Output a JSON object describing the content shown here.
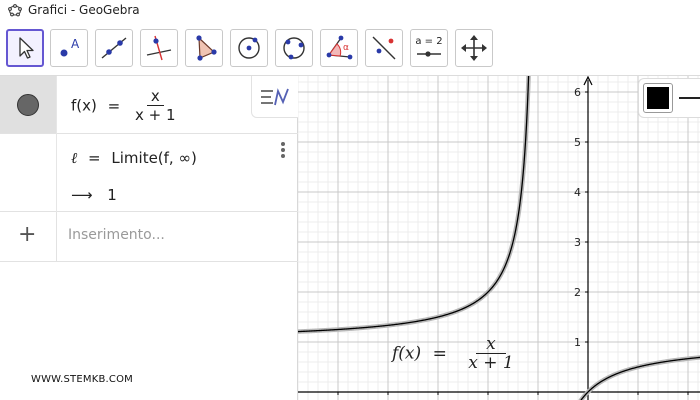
{
  "window": {
    "title": "Grafici - GeoGebra"
  },
  "toolbar": {
    "tools": [
      {
        "id": "move",
        "icon": "cursor-arrow-icon",
        "active": true
      },
      {
        "id": "point",
        "icon": "point-icon",
        "label": "A"
      },
      {
        "id": "line",
        "icon": "line-through-points-icon"
      },
      {
        "id": "perpendicular",
        "icon": "perpendicular-line-icon"
      },
      {
        "id": "polygon",
        "icon": "polygon-icon"
      },
      {
        "id": "circle-center",
        "icon": "circle-center-point-icon"
      },
      {
        "id": "circle-three",
        "icon": "circle-three-points-icon"
      },
      {
        "id": "angle",
        "icon": "angle-icon",
        "label": "α"
      },
      {
        "id": "reflect",
        "icon": "reflect-line-icon"
      },
      {
        "id": "slider",
        "icon": "slider-icon",
        "label": "a = 2"
      },
      {
        "id": "move-view",
        "icon": "move-graphics-view-icon"
      }
    ]
  },
  "algebra": {
    "row1": {
      "name": "f(x)",
      "eq": "=",
      "num": "x",
      "den": "x + 1"
    },
    "row2": {
      "lhs": "ℓ",
      "eq": "=",
      "command": "Limite(f, ∞)",
      "arrow": "⟶",
      "result": "1"
    },
    "input": {
      "plus": "+",
      "placeholder": "Inserimento..."
    }
  },
  "watermark": "WWW.STEMKB.COM",
  "graphics": {
    "y_ticks": [
      "1",
      "2",
      "3",
      "4",
      "5",
      "6"
    ],
    "label": {
      "name": "f(x)",
      "eq": "=",
      "num": "x",
      "den": "x + 1"
    },
    "colors": {
      "curve": "#000000",
      "curve_halo": "#b8b8b8",
      "axis": "#000000",
      "grid_major": "#c8c8c8",
      "grid_minor": "#ececec"
    }
  }
}
